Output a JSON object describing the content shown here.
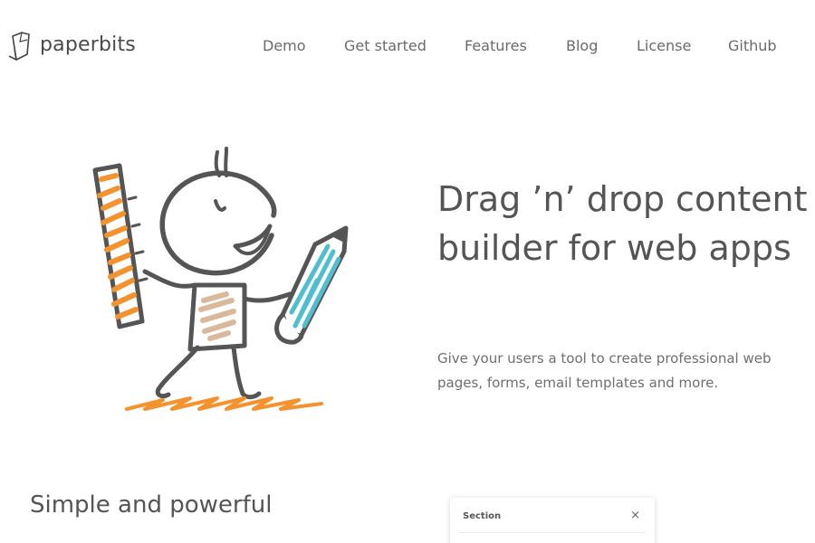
{
  "brand": {
    "name": "paperbits",
    "logo_icon": "paper-sheet-icon"
  },
  "nav": {
    "items": [
      {
        "label": "Demo"
      },
      {
        "label": "Get started"
      },
      {
        "label": "Features"
      },
      {
        "label": "Blog"
      },
      {
        "label": "License"
      },
      {
        "label": "Github"
      }
    ]
  },
  "hero": {
    "title": "Drag ’n’ drop content builder for web apps",
    "subtitle": "Give your users a tool to create professional web pages, forms, email templates and more.",
    "illustration": "stick-figure-with-ruler-and-pencil"
  },
  "features": {
    "heading": "Simple and powerful"
  },
  "panel": {
    "title": "Section",
    "close": "×"
  },
  "colors": {
    "orange": "#f4922e",
    "teal": "#4fbfcf",
    "beige": "#d9b99a",
    "ink": "#555555",
    "text": "#6a6a6a"
  }
}
